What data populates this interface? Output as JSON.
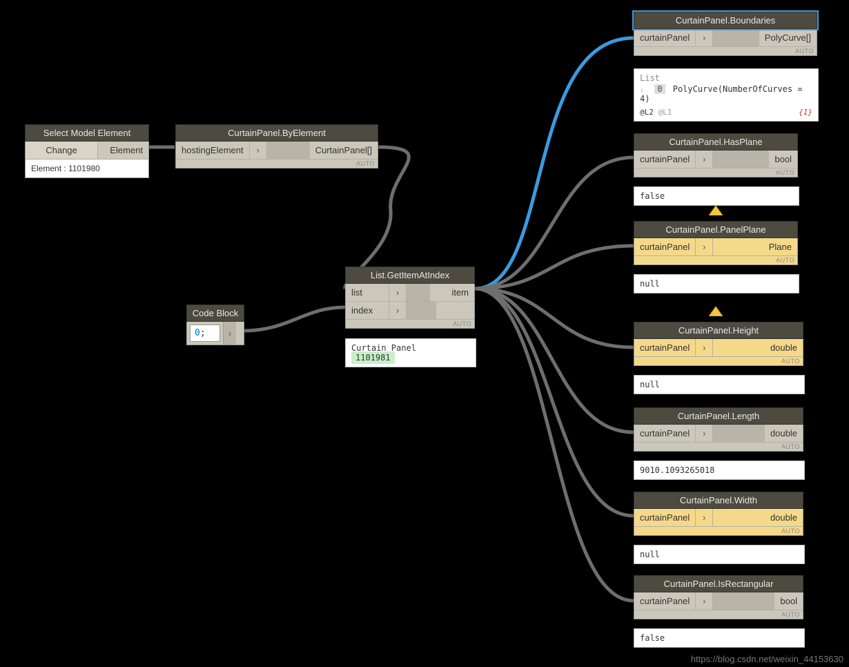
{
  "nodes": {
    "selectModel": {
      "title": "Select Model Element",
      "button": "Change",
      "output": "Element",
      "info": "Element : 1101980"
    },
    "byElement": {
      "title": "CurtainPanel.ByElement",
      "input": "hostingElement",
      "output": "CurtainPanel[]",
      "auto": "AUTO"
    },
    "codeBlock": {
      "title": "Code Block",
      "code": "0",
      "codeSuffix": ";"
    },
    "getItem": {
      "title": "List.GetItemAtIndex",
      "in1": "list",
      "in2": "index",
      "out": "item",
      "auto": "AUTO",
      "previewLabel": "Curtain Panel",
      "previewValue": "1101981"
    },
    "boundaries": {
      "title": "CurtainPanel.Boundaries",
      "input": "curtainPanel",
      "output": "PolyCurve[]",
      "auto": "AUTO",
      "preview": {
        "head": "List",
        "idx": "0",
        "item": "PolyCurve(NumberOfCurves = 4)",
        "l2": "@L2",
        "l1": "@L1",
        "count": "{1}"
      }
    },
    "hasPlane": {
      "title": "CurtainPanel.HasPlane",
      "input": "curtainPanel",
      "output": "bool",
      "auto": "AUTO",
      "preview": "false"
    },
    "panelPlane": {
      "title": "CurtainPanel.PanelPlane",
      "input": "curtainPanel",
      "output": "Plane",
      "auto": "AUTO",
      "preview": "null",
      "warn": true
    },
    "height": {
      "title": "CurtainPanel.Height",
      "input": "curtainPanel",
      "output": "double",
      "auto": "AUTO",
      "preview": "null",
      "warn": true
    },
    "length": {
      "title": "CurtainPanel.Length",
      "input": "curtainPanel",
      "output": "double",
      "auto": "AUTO",
      "preview": "9010.1093265018"
    },
    "width": {
      "title": "CurtainPanel.Width",
      "input": "curtainPanel",
      "output": "double",
      "auto": "AUTO",
      "preview": "null",
      "warn": true
    },
    "isRect": {
      "title": "CurtainPanel.IsRectangular",
      "input": "curtainPanel",
      "output": "bool",
      "auto": "AUTO",
      "preview": "false"
    }
  },
  "watermark": "https://blog.csdn.net/weixin_44153630"
}
